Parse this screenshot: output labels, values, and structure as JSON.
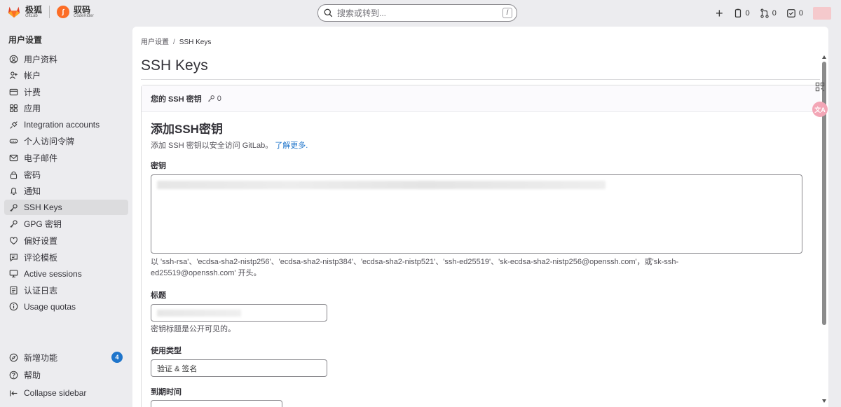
{
  "brand": {
    "name": "极狐",
    "sub": "GitLab",
    "name2": "驭码",
    "sub2": "CodeRider"
  },
  "search": {
    "placeholder": "搜索或转到...",
    "shortcut": "/"
  },
  "top_actions": {
    "plus": "+",
    "issues_count": "0",
    "mr_count": "0",
    "todo_count": "0"
  },
  "sidebar": {
    "title": "用户设置",
    "items": [
      {
        "label": "用户资料",
        "icon": "profile-icon"
      },
      {
        "label": "帐户",
        "icon": "account-icon"
      },
      {
        "label": "计费",
        "icon": "billing-icon"
      },
      {
        "label": "应用",
        "icon": "applications-icon"
      },
      {
        "label": "Integration accounts",
        "icon": "integration-icon"
      },
      {
        "label": "个人访问令牌",
        "icon": "token-icon"
      },
      {
        "label": "电子邮件",
        "icon": "mail-icon"
      },
      {
        "label": "密码",
        "icon": "lock-icon"
      },
      {
        "label": "通知",
        "icon": "bell-icon"
      },
      {
        "label": "SSH Keys",
        "icon": "key-icon",
        "active": true
      },
      {
        "label": "GPG 密钥",
        "icon": "key-icon"
      },
      {
        "label": "偏好设置",
        "icon": "preferences-icon"
      },
      {
        "label": "评论模板",
        "icon": "comment-icon"
      },
      {
        "label": "Active sessions",
        "icon": "monitor-icon"
      },
      {
        "label": "认证日志",
        "icon": "log-icon"
      },
      {
        "label": "Usage quotas",
        "icon": "info-icon"
      }
    ],
    "bottom": {
      "whats_new": "新增功能",
      "whats_new_badge": "4",
      "help": "帮助",
      "collapse": "Collapse sidebar"
    }
  },
  "breadcrumb": {
    "parent": "用户设置",
    "current": "SSH Keys"
  },
  "page_title": "SSH Keys",
  "card": {
    "header": "您的 SSH 密钥",
    "count": "0",
    "form_title": "添加SSH密钥",
    "form_desc": "添加 SSH 密钥以安全访问 GitLab。",
    "learn_more": "了解更多.",
    "key_label": "密钥",
    "key_help": "以 'ssh-rsa'、'ecdsa-sha2-nistp256'、'ecdsa-sha2-nistp384'、'ecdsa-sha2-nistp521'、'ssh-ed25519'、'sk-ecdsa-sha2-nistp256@openssh.com'，或'sk-ssh-ed25519@openssh.com' 开头。",
    "title_label": "标题",
    "title_help": "密钥标题是公开可见的。",
    "usage_label": "使用类型",
    "usage_value": "验证 & 签名",
    "expires_label": "到期时间"
  },
  "colors": {
    "accent": "#1f75cb",
    "active_bg": "#dcdcde",
    "brand_orange": "#fc6d26"
  }
}
